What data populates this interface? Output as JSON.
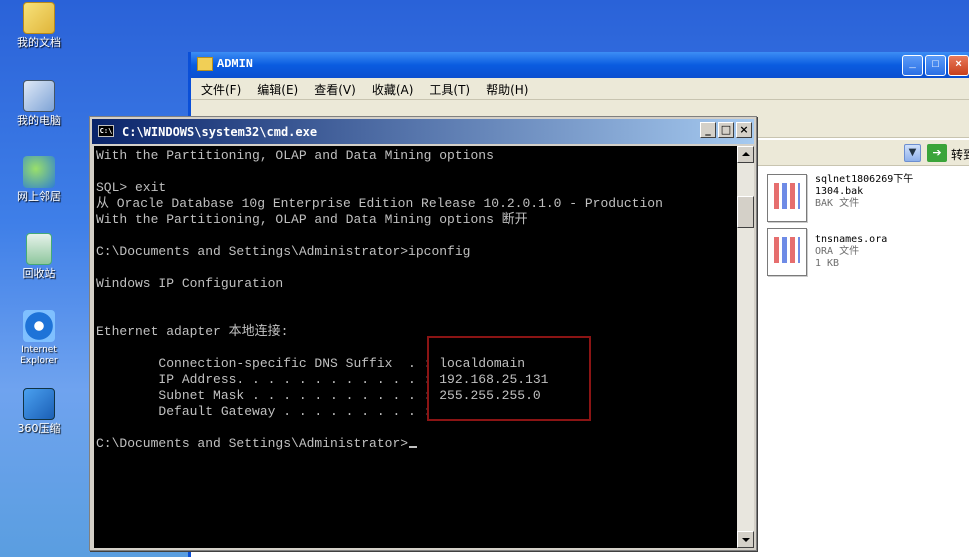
{
  "desktop": {
    "icons": [
      {
        "label": "我的文档",
        "icon": "my-documents-icon"
      },
      {
        "label": "我的电脑",
        "icon": "my-computer-icon"
      },
      {
        "label": "网上邻居",
        "icon": "network-places-icon"
      },
      {
        "label": "回收站",
        "icon": "recycle-bin-icon"
      },
      {
        "label": "Internet Explorer",
        "icon": "internet-explorer-icon"
      },
      {
        "label": "360压缩",
        "icon": "360zip-icon"
      }
    ]
  },
  "explorer": {
    "title": "ADMIN",
    "menu": [
      "文件(F)",
      "编辑(E)",
      "查看(V)",
      "收藏(A)",
      "工具(T)",
      "帮助(H)"
    ],
    "go_label": "转到",
    "files": [
      {
        "name_line1": "sqlnet1806269下午",
        "name_line2": "1304.bak",
        "type": "BAK 文件",
        "size": ""
      },
      {
        "name_line1": "tnsnames.ora",
        "name_line2": "",
        "type": "ORA 文件",
        "size": "1 KB"
      }
    ]
  },
  "cmd": {
    "title": "C:\\WINDOWS\\system32\\cmd.exe",
    "lines": [
      "With the Partitioning, OLAP and Data Mining options",
      "",
      "SQL> exit",
      "从 Oracle Database 10g Enterprise Edition Release 10.2.0.1.0 - Production",
      "With the Partitioning, OLAP and Data Mining options 断开",
      "",
      "C:\\Documents and Settings\\Administrator>ipconfig",
      "",
      "Windows IP Configuration",
      "",
      "",
      "Ethernet adapter 本地连接:",
      "",
      "        Connection-specific DNS Suffix  . : localdomain",
      "        IP Address. . . . . . . . . . . . : 192.168.25.131",
      "        Subnet Mask . . . . . . . . . . . : 255.255.255.0",
      "        Default Gateway . . . . . . . . . :",
      "",
      "C:\\Documents and Settings\\Administrator>"
    ]
  },
  "colors": {
    "highlight_box": "#8b1414",
    "cmd_text": "#c0c0c0",
    "cmd_bg": "#000000"
  }
}
